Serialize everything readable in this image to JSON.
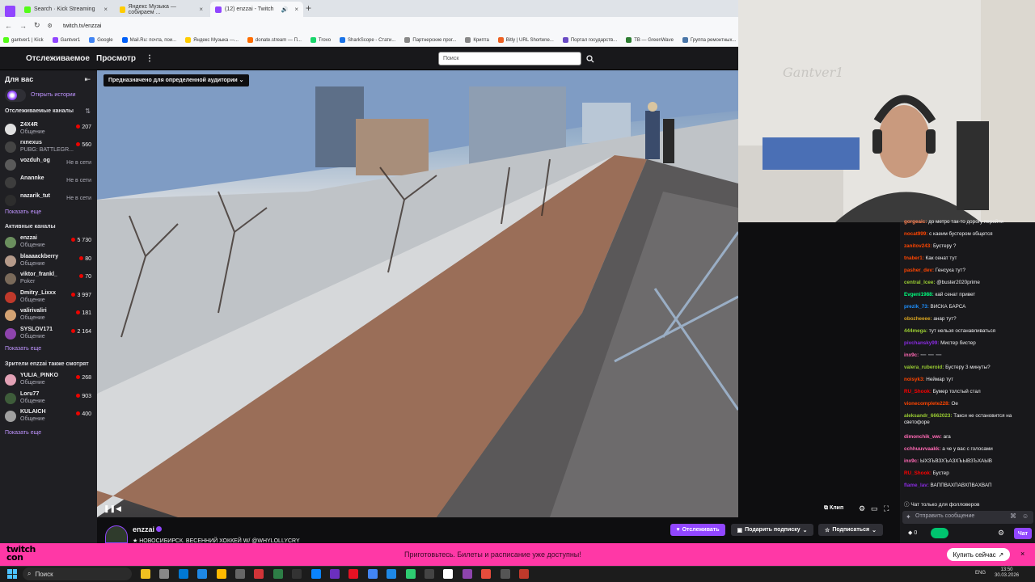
{
  "browser": {
    "tabs": [
      {
        "label": "Search · Kick Streaming",
        "color": "#53fc18"
      },
      {
        "label": "Яндекс Музыка — собираем ...",
        "color": "#ffcc00"
      },
      {
        "label": "(12) enzzai - Twitch",
        "color": "#9146ff"
      }
    ],
    "url": "twitch.tv/enzzai",
    "bookmarks": [
      {
        "label": "gantver1 | Kick",
        "color": "#53fc18"
      },
      {
        "label": "Gantver1",
        "color": "#9146ff"
      },
      {
        "label": "Google",
        "color": "#4285f4"
      },
      {
        "label": "Mail.Ru: почта, пои...",
        "color": "#005ff9"
      },
      {
        "label": "Яндекс Музыка —...",
        "color": "#ffcc00"
      },
      {
        "label": "donate.stream — П...",
        "color": "#ff6d00"
      },
      {
        "label": "Trovo",
        "color": "#19d66b"
      },
      {
        "label": "SharkScope - Стати...",
        "color": "#1a73e8"
      },
      {
        "label": "Партнерские прог...",
        "color": "#888888"
      },
      {
        "label": "Крипта",
        "color": "#888888"
      },
      {
        "label": "Bitly | URL Shortene...",
        "color": "#ee6123"
      },
      {
        "label": "Портал государств...",
        "color": "#6a4bc4"
      },
      {
        "label": "TB — GreenWave",
        "color": "#2e7d32"
      },
      {
        "label": "Группа ремонтных...",
        "color": "#4a76a8"
      }
    ]
  },
  "topnav": {
    "following": "Отслеживаемое",
    "browse": "Просмотр",
    "more": "⋮",
    "search_placeholder": "Поиск"
  },
  "sidebar": {
    "title": "Для вас",
    "stories": "Открыть истории",
    "followed_title": "Отслеживаемые каналы",
    "followed": [
      {
        "name": "Z4X4R",
        "category": "Общение",
        "viewers": "207",
        "live": true,
        "color": "#e0e0e0"
      },
      {
        "name": "rxnexus",
        "category": "PUBG: BATTLEGR...",
        "viewers": "560",
        "live": true,
        "color": "#444444"
      },
      {
        "name": "vozduh_og",
        "category": "",
        "viewers": "Не в сети",
        "live": false,
        "color": "#5a5a5a"
      },
      {
        "name": "Anannke",
        "category": "",
        "viewers": "Не в сети",
        "live": false,
        "color": "#3d3d3d"
      },
      {
        "name": "nazarik_tut",
        "category": "",
        "viewers": "Не в сети",
        "live": false,
        "color": "#2d2d2d"
      }
    ],
    "show_more": "Показать еще",
    "active_title": "Активные каналы",
    "active": [
      {
        "name": "enzzai",
        "category": "Общение",
        "viewers": "5 730",
        "live": true,
        "color": "#6b8f5e"
      },
      {
        "name": "blaaaackberry",
        "category": "Общение",
        "viewers": "80",
        "live": true,
        "color": "#b59a8a"
      },
      {
        "name": "viktor_frankl_",
        "category": "Poker",
        "viewers": "70",
        "live": true,
        "color": "#7a6a5a"
      },
      {
        "name": "Dmitry_Lixxx",
        "category": "Общение",
        "viewers": "3 997",
        "live": true,
        "color": "#c0392b"
      },
      {
        "name": "valirivaliri",
        "category": "Общение",
        "viewers": "181",
        "live": true,
        "color": "#d4a373"
      },
      {
        "name": "SYSLOV171",
        "category": "Общение",
        "viewers": "2 164",
        "live": true,
        "color": "#8e44ad"
      }
    ],
    "show_more2": "Показать еще",
    "also_title": "Зрители enzzai также смотрят",
    "also": [
      {
        "name": "YULIA_PINKO",
        "category": "Общение",
        "viewers": "268",
        "live": true,
        "color": "#e2a1b5"
      },
      {
        "name": "Loru77",
        "category": "Общение",
        "viewers": "903",
        "live": true,
        "color": "#3e5c3a"
      },
      {
        "name": "KULAICH",
        "category": "Общение",
        "viewers": "400",
        "live": true,
        "color": "#a0a0a0"
      }
    ],
    "show_more3": "Показать еще"
  },
  "video": {
    "mature_label": "Предназначено для определенной аудитории",
    "clip": "Клип"
  },
  "cam": {
    "wall_text": "Gantver1"
  },
  "chat": {
    "messages": [
      {
        "user": "gorgeaic:",
        "text": " до метро так-то дорогу перейти",
        "color": "#ff7f50"
      },
      {
        "user": "nocat999:",
        "text": " с каеим бустером общется",
        "color": "#ff4500"
      },
      {
        "user": "zanitov243:",
        "text": " Бустеру ?",
        "color": "#ff4500"
      },
      {
        "user": "tnaber1:",
        "text": " Как сенат тут",
        "color": "#ff4500"
      },
      {
        "user": "pasher_dev:",
        "text": " Генсуха тут?",
        "color": "#ff4500"
      },
      {
        "user": "central_lcee:",
        "text": " @buster2020prime",
        "color": "#9acd32"
      },
      {
        "user": "Evgeni1988:",
        "text": " кай сенат привет",
        "color": "#00ff7f"
      },
      {
        "user": "prezik_73:",
        "text": " ВИСКА БАРСА",
        "color": "#1e90ff"
      },
      {
        "user": "obozheeee:",
        "text": " анар тут?",
        "color": "#daa520"
      },
      {
        "user": "444mega:",
        "text": " тут нельзя останавливаться",
        "color": "#9acd32"
      },
      {
        "user": "pivchansky99:",
        "text": " Мистер бистер",
        "color": "#8a2be2"
      },
      {
        "user": "inx9c:",
        "text": " ➖ ➖ ➖",
        "color": "#ff69b4"
      },
      {
        "user": "valera_ruberoid:",
        "text": " Бустеру 3 минуты?",
        "color": "#9acd32"
      },
      {
        "user": "noisyk3:",
        "text": " Неймар тут",
        "color": "#ff4500"
      },
      {
        "user": "RU_Shook:",
        "text": " Бумер толстый стал",
        "color": "#ff0000"
      },
      {
        "user": "vionecomplete228:",
        "text": " Ое",
        "color": "#ff4500"
      },
      {
        "user": "aleksandr_6662023:",
        "text": " Такси не остановится на светофоре",
        "color": "#9acd32"
      },
      {
        "user": "dimonchik_ww:",
        "text": " ага",
        "color": "#ff69b4"
      },
      {
        "user": "cchhuuvvaakk:",
        "text": " а че у вас с голосами",
        "color": "#ff69b4"
      },
      {
        "user": "inx9c:",
        "text": " ЫХЗЪВЗХЪАЗХЪЫВЗЪХАЫВ",
        "color": "#ff69b4"
      },
      {
        "user": "RU_Shook:",
        "text": " Бустер",
        "color": "#ff0000"
      },
      {
        "user": "flame_lav:",
        "text": " ВАППВАХПАВХПВАХВАП",
        "color": "#8a2be2"
      }
    ],
    "followers_only": "Чат только для фолловеров",
    "input_placeholder": "Отправить сообщение",
    "points": "0",
    "chat_button": "Чат"
  },
  "stream": {
    "name": "enzzai",
    "title": "★ НОВОСИБИРСК. ВЕСЕННИЙ ХОККЕЙ W/ @WHYLOLLYCRY",
    "follow": "Отслеживать",
    "gift": "Подарить подписку",
    "subscribe": "Подписаться"
  },
  "banner": {
    "logo_line1": "twitch",
    "logo_line2": "con",
    "text": "Приготовьтесь. Билеты и расписание уже доступны!",
    "cta": "Купить сейчас",
    "close": "×"
  },
  "taskbar": {
    "search": "Поиск",
    "lang": "ENG",
    "time": "13:50",
    "date": "30.03.2026"
  }
}
